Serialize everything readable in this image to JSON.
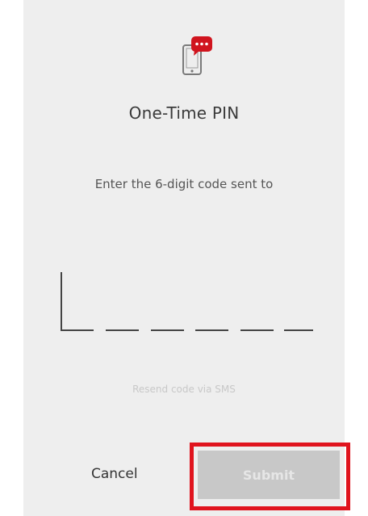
{
  "dialog": {
    "icon": "phone-message-icon",
    "title": "One-Time PIN",
    "instruction": "Enter the 6-digit code sent to"
  },
  "pin": {
    "digits": 6,
    "value": ""
  },
  "resend": {
    "label": "Resend code via SMS"
  },
  "actions": {
    "cancel_label": "Cancel",
    "submit_label": "Submit",
    "submit_enabled": false
  },
  "colors": {
    "accent": "#e0141e",
    "card_background": "#eeeeee",
    "disabled_button": "#c8c8c8"
  }
}
